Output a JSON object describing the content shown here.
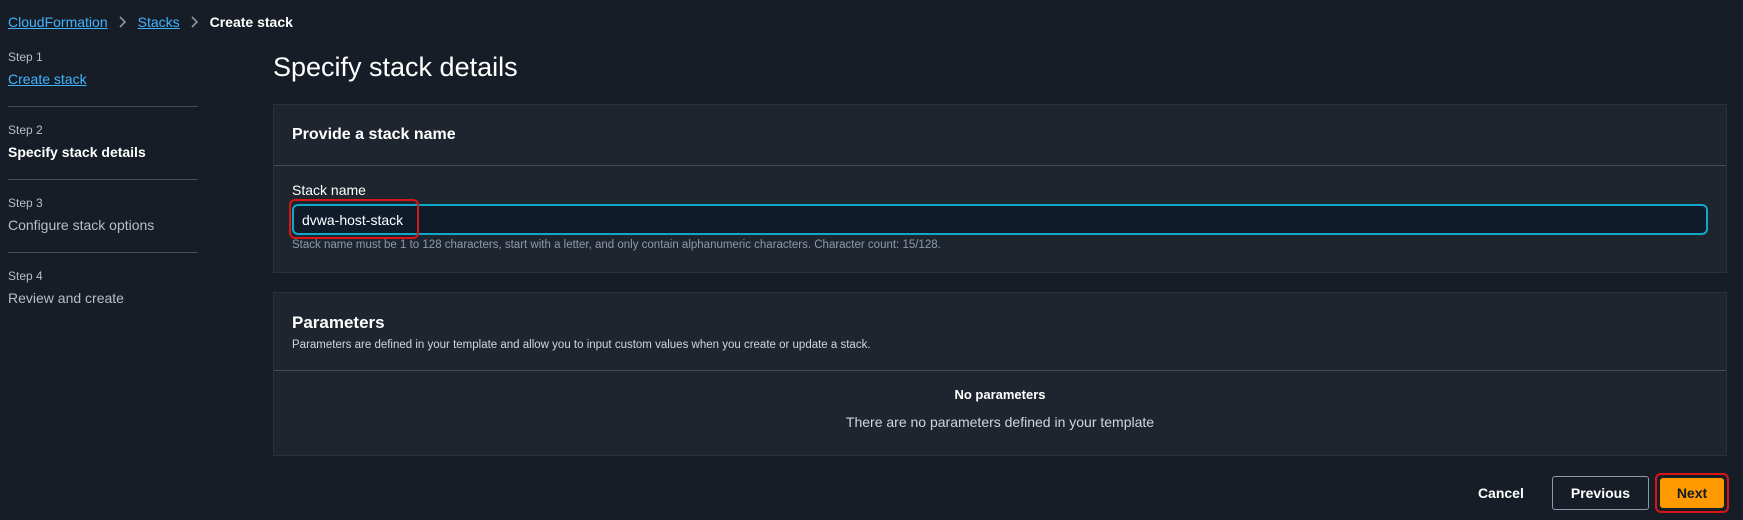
{
  "breadcrumb": {
    "items": [
      "CloudFormation",
      "Stacks"
    ],
    "current": "Create stack"
  },
  "steps": [
    {
      "number": "Step 1",
      "title": "Create stack"
    },
    {
      "number": "Step 2",
      "title": "Specify stack details"
    },
    {
      "number": "Step 3",
      "title": "Configure stack options"
    },
    {
      "number": "Step 4",
      "title": "Review and create"
    }
  ],
  "page_title": "Specify stack details",
  "stack_name_panel": {
    "header": "Provide a stack name",
    "label": "Stack name",
    "value": "dvwa-host-stack",
    "hint": "Stack name must be 1 to 128 characters, start with a letter, and only contain alphanumeric characters. Character count: 15/128."
  },
  "parameters_panel": {
    "header": "Parameters",
    "description": "Parameters are defined in your template and allow you to input custom values when you create or update a stack.",
    "empty_title": "No parameters",
    "empty_text": "There are no parameters defined in your template"
  },
  "actions": {
    "cancel": "Cancel",
    "previous": "Previous",
    "next": "Next"
  },
  "colors": {
    "link": "#42b4ff",
    "primary": "#ff9900",
    "focus": "#0fa8c7",
    "annotation": "#d91515"
  }
}
